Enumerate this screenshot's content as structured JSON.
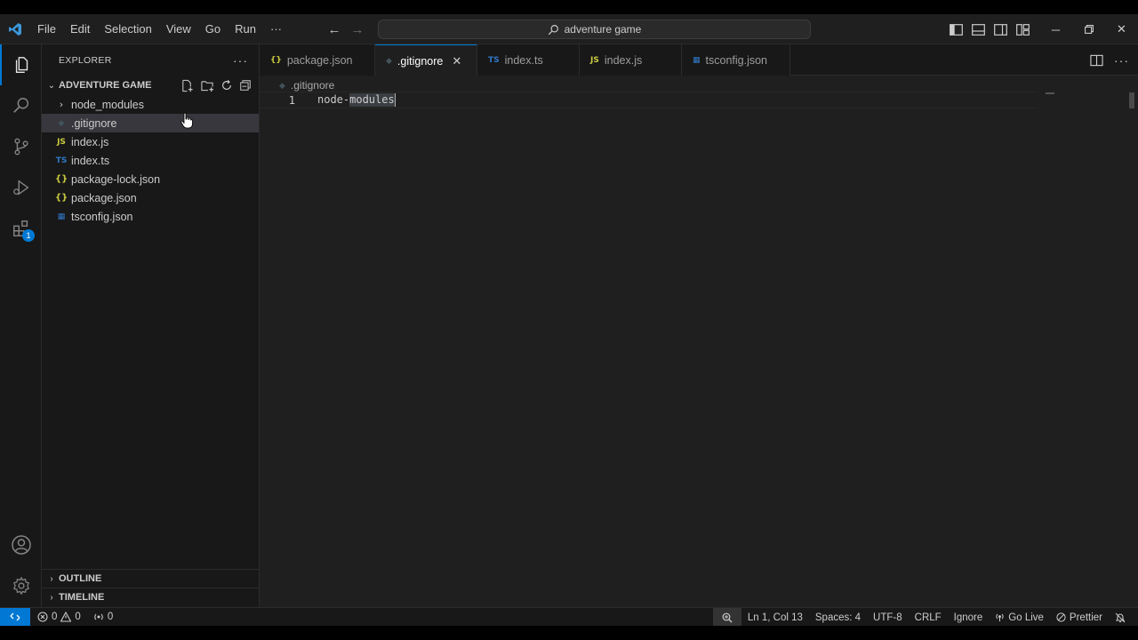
{
  "titlebar": {
    "menu": [
      "File",
      "Edit",
      "Selection",
      "View",
      "Go",
      "Run",
      "···"
    ],
    "search_text": "adventure game"
  },
  "sidebar": {
    "title": "EXPLORER",
    "more": "···",
    "folder_name": "ADVENTURE GAME",
    "items": [
      {
        "label": "node_modules",
        "type": "folder",
        "icon": "›"
      },
      {
        "label": ".gitignore",
        "type": "git",
        "icon": "◆"
      },
      {
        "label": "index.js",
        "type": "js",
        "icon": "JS"
      },
      {
        "label": "index.ts",
        "type": "ts",
        "icon": "TS"
      },
      {
        "label": "package-lock.json",
        "type": "json",
        "icon": "{}"
      },
      {
        "label": "package.json",
        "type": "json",
        "icon": "{}"
      },
      {
        "label": "tsconfig.json",
        "type": "cfg",
        "icon": "▦"
      }
    ],
    "outline_label": "OUTLINE",
    "timeline_label": "TIMELINE"
  },
  "tabs": [
    {
      "label": "package.json",
      "icon": "{}",
      "icon_color": "#cbcb41"
    },
    {
      "label": ".gitignore",
      "icon": "◆",
      "icon_color": "#41535b",
      "active": true
    },
    {
      "label": "index.ts",
      "icon": "TS",
      "icon_color": "#3178c6"
    },
    {
      "label": "index.js",
      "icon": "JS",
      "icon_color": "#cbcb41"
    },
    {
      "label": "tsconfig.json",
      "icon": "▦",
      "icon_color": "#3178c6"
    }
  ],
  "editor": {
    "breadcrumb": ".gitignore",
    "line_number": "1",
    "code_prefix": "node-",
    "code_selected": "modules"
  },
  "statusbar": {
    "errors": "0",
    "warnings": "0",
    "ports": "0",
    "position": "Ln 1, Col 13",
    "spaces": "Spaces: 4",
    "encoding": "UTF-8",
    "eol": "CRLF",
    "language": "Ignore",
    "golive": "Go Live",
    "prettier": "Prettier"
  },
  "colors": {
    "accent": "#0078d4",
    "background": "#1f1f1f",
    "sidebar": "#181818"
  }
}
